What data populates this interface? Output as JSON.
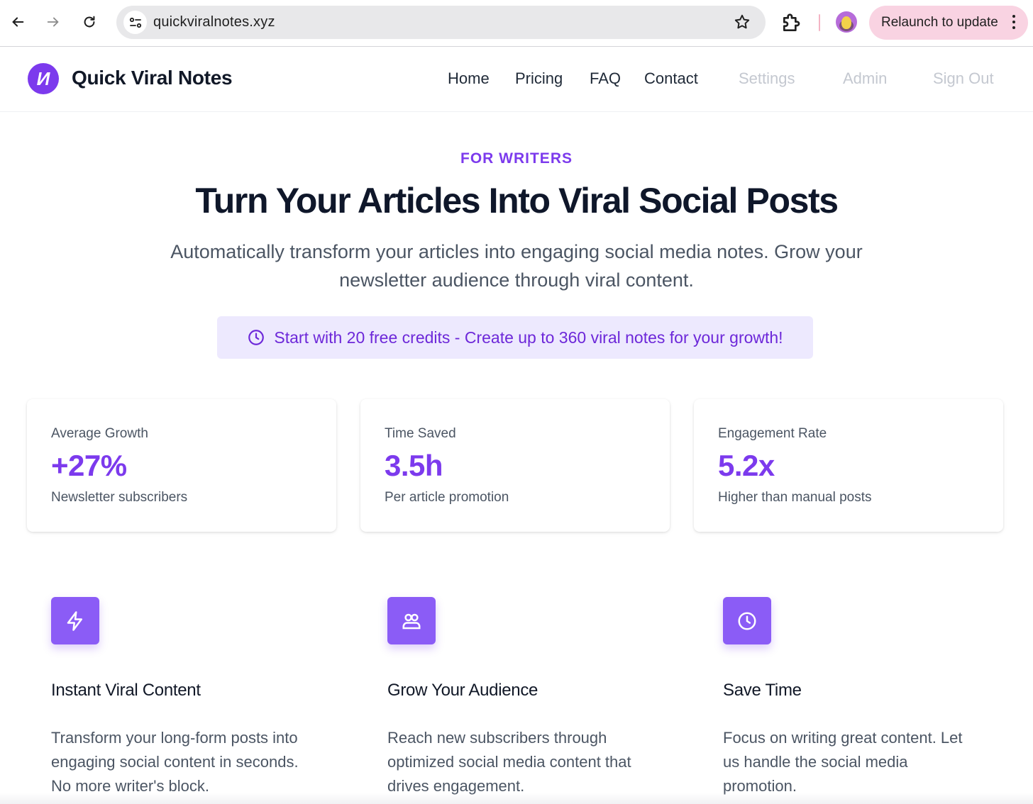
{
  "browser": {
    "url": "quickviralnotes.xyz",
    "relaunch_label": "Relaunch to update",
    "icons": [
      "back-arrow-icon",
      "forward-arrow-icon",
      "reload-icon",
      "site-settings-icon",
      "bookmark-star-icon",
      "extensions-puzzle-icon",
      "profile-avatar",
      "kebab-menu-icon"
    ]
  },
  "header": {
    "logo_glyph": "И",
    "brand": "Quick Viral Notes",
    "nav": {
      "home": "Home",
      "pricing": "Pricing",
      "faq": "FAQ",
      "contact": "Contact",
      "settings": "Settings",
      "admin": "Admin",
      "sign_out": "Sign Out"
    }
  },
  "hero": {
    "eyebrow": "FOR WRITERS",
    "title": "Turn Your Articles Into Viral Social Posts",
    "subtitle": "Automatically transform your articles into engaging social media notes. Grow your newsletter audience through viral content.",
    "credits_banner": "Start with 20 free credits - Create up to 360 viral notes for your growth!"
  },
  "stats": [
    {
      "label": "Average Growth",
      "value": "+27%",
      "desc": "Newsletter subscribers"
    },
    {
      "label": "Time Saved",
      "value": "3.5h",
      "desc": "Per article promotion"
    },
    {
      "label": "Engagement Rate",
      "value": "5.2x",
      "desc": "Higher than manual posts"
    }
  ],
  "features": [
    {
      "icon": "lightning-bolt-icon",
      "title": "Instant Viral Content",
      "desc": "Transform your long-form posts into engaging social content in seconds. No more writer's block."
    },
    {
      "icon": "users-group-icon",
      "title": "Grow Your Audience",
      "desc": "Reach new subscribers through optimized social media content that drives engagement."
    },
    {
      "icon": "clock-icon",
      "title": "Save Time",
      "desc": "Focus on writing great content. Let us handle the social media promotion."
    }
  ],
  "colors": {
    "accent": "#7c3aed",
    "accent_light": "#ede9fe",
    "icon_box": "#8b5cf6",
    "relaunch_bg": "#f9d3e2"
  }
}
